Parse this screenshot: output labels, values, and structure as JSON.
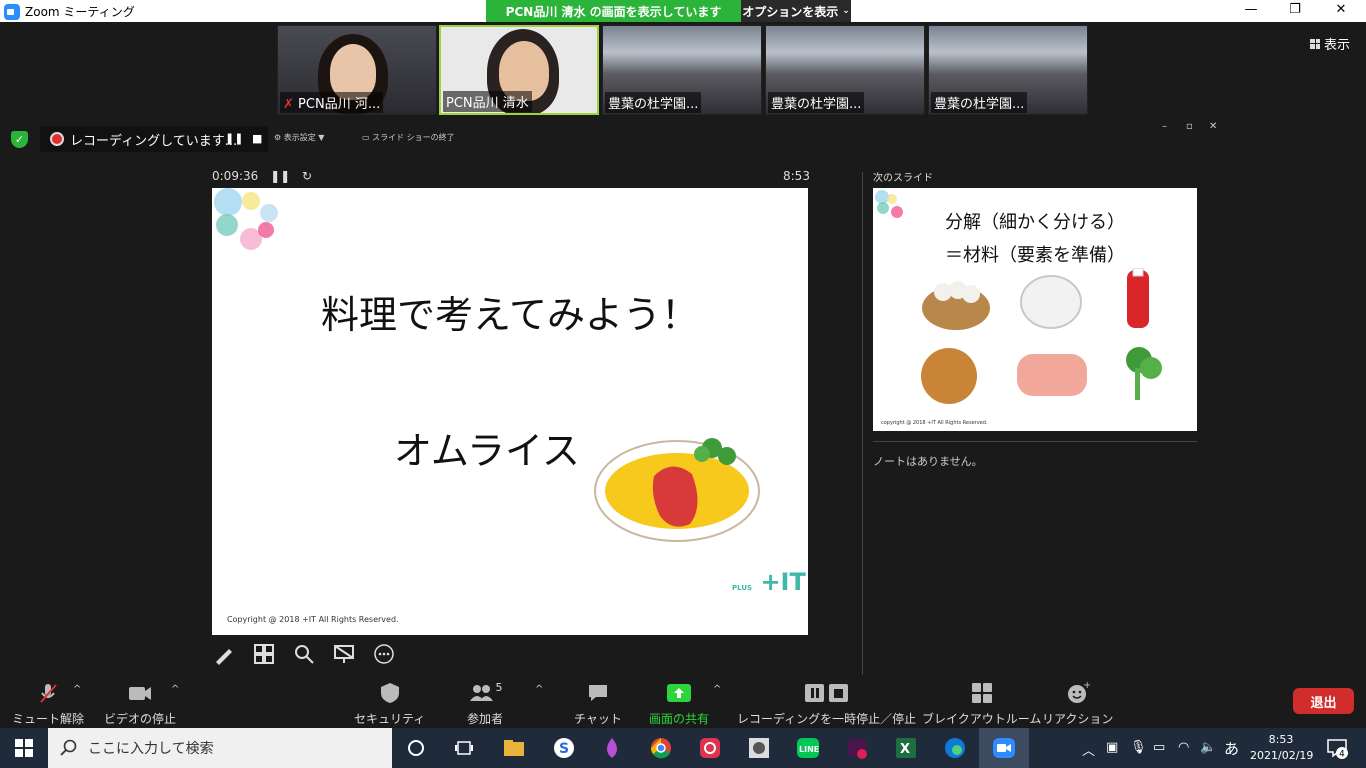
{
  "window": {
    "title": "Zoom ミーティング",
    "share_banner": "PCN品川 清水 の画面を表示しています",
    "options_label": "オプションを表示",
    "minimize": "—",
    "maximize": "❐",
    "close": "✕"
  },
  "participants": [
    {
      "name": "PCN品川 河...",
      "muted": true
    },
    {
      "name": "PCN品川 清水",
      "muted": false,
      "active": true
    },
    {
      "name": "豊葉の杜学園..."
    },
    {
      "name": "豊葉の杜学園..."
    },
    {
      "name": "豊葉の杜学園..."
    }
  ],
  "view_label": "表示",
  "recording": {
    "status": "レコーディングしています...",
    "pp_display": "表示設定 ▼",
    "pp_end": "スライド ショーの終了"
  },
  "presenter": {
    "elapsed": "0:09:36",
    "clock": "8:53",
    "slide": {
      "title": "料理で考えてみよう！",
      "dish": "オムライス",
      "copyright": "Copyright @ 2018 +IT All Rights Reserved.",
      "logo": "+IT",
      "logo_small": "PLUS"
    },
    "next_label": "次のスライド",
    "next_slide": {
      "line1": "分解（細かく分ける）",
      "line2": "＝材料（要素を準備）",
      "copyright": "copyright @ 2018 +IT All Rights Reserved."
    },
    "notes": "ノートはありません。"
  },
  "toolbar": {
    "mute": "ミュート解除",
    "video": "ビデオの停止",
    "security": "セキュリティ",
    "participants": "参加者",
    "participant_count": "5",
    "chat": "チャット",
    "share": "画面の共有",
    "record": "レコーディングを一時停止／停止",
    "breakout": "ブレイクアウトルーム",
    "reactions": "リアクション",
    "leave": "退出"
  },
  "taskbar": {
    "search_placeholder": "ここに入力して検索",
    "time": "8:53",
    "date": "2021/02/19",
    "ime": "あ",
    "notification_count": "4"
  },
  "colors": {
    "accent_green": "#2bb33a",
    "leave_red": "#d12d2d",
    "zoom_blue": "#2d8cff"
  }
}
